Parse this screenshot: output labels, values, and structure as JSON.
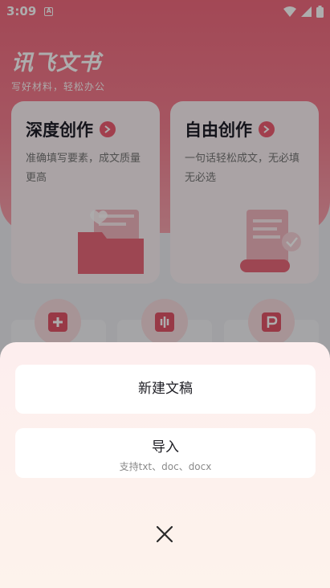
{
  "status_bar": {
    "time": "3:09",
    "notification_letter": "A"
  },
  "brand": {
    "title": "讯飞文书",
    "subtitle": "写好材料，轻松办公"
  },
  "cards": [
    {
      "title": "深度创作",
      "desc": "准确填写要素，成文质量更高"
    },
    {
      "title": "自由创作",
      "desc": "一句话轻松成文，无必填无必选"
    }
  ],
  "sheet": {
    "new_doc_label": "新建文稿",
    "import_label": "导入",
    "import_hint": "支持txt、doc、docx"
  },
  "colors": {
    "accent": "#ee5d72",
    "sheet_bg": "#fdeeee"
  },
  "icons": {
    "close": "close-icon",
    "arrow": "arrow-right-icon"
  }
}
